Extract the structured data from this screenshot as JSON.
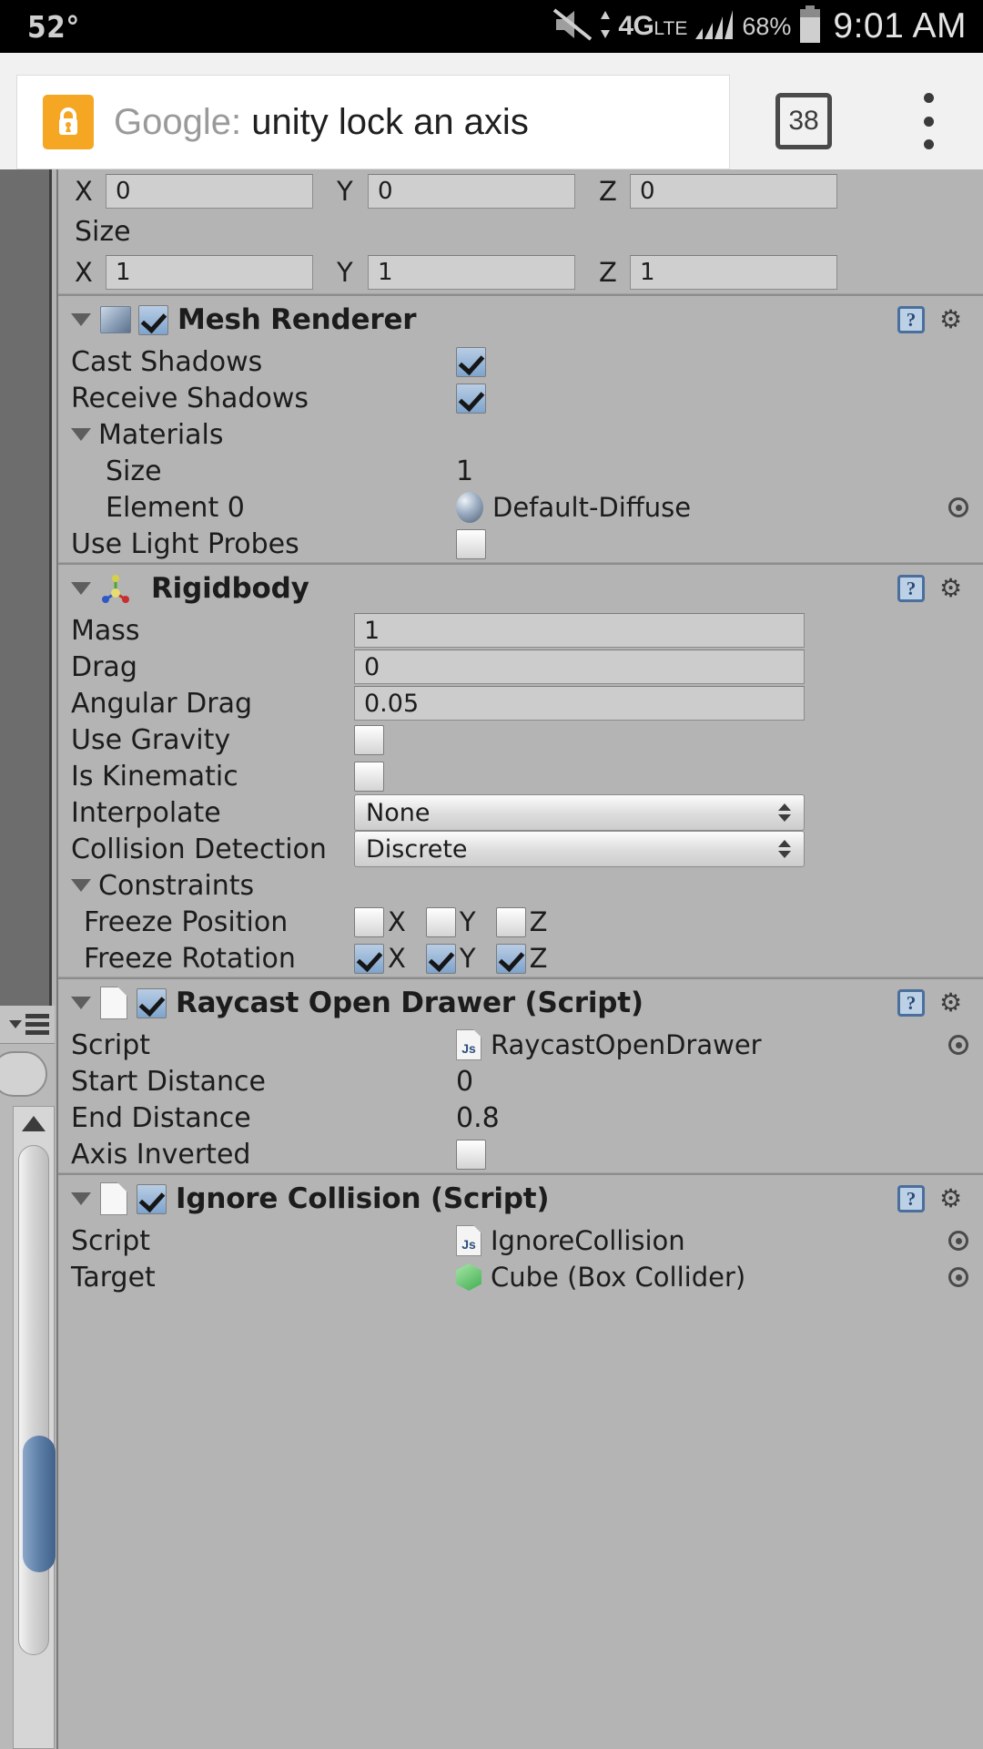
{
  "statusbar": {
    "temperature": "52°",
    "mute_icon": "mute-icon",
    "network": "4G",
    "network_suffix": "LTE",
    "signal_icon": "signal-bars-icon",
    "battery_percent": "68%",
    "battery_icon": "battery-icon",
    "time": "9:01 AM"
  },
  "browser": {
    "lock_icon": "lock-icon",
    "omnibox_prefix": "Google:",
    "omnibox_query": " unity lock an axis",
    "tab_count": "38",
    "menu_icon": "kebab-menu-icon",
    "accent_color": "#f5a623"
  },
  "inspector": {
    "transform_tail": {
      "position_row": {
        "x_label": "X",
        "x_value": "0",
        "y_label": "Y",
        "y_value": "0",
        "z_label": "Z",
        "z_value": "0"
      },
      "size_label": "Size",
      "size_row": {
        "x_label": "X",
        "x_value": "1",
        "y_label": "Y",
        "y_value": "1",
        "z_label": "Z",
        "z_value": "1"
      }
    },
    "mesh_renderer": {
      "title": "Mesh Renderer",
      "enabled": true,
      "icon": "mesh-renderer-icon",
      "help_glyph": "?",
      "gear_glyph": "⚙",
      "props": [
        {
          "label": "Cast Shadows",
          "type": "checkbox",
          "value": true
        },
        {
          "label": "Receive Shadows",
          "type": "checkbox",
          "value": true
        },
        {
          "label": "Materials",
          "type": "foldout"
        },
        {
          "label": "Size",
          "type": "text",
          "value": "1",
          "indent": 2
        },
        {
          "label": "Element 0",
          "type": "object",
          "value": "Default-Diffuse",
          "indent": 2,
          "icon": "material-sphere-icon"
        },
        {
          "label": "Use Light Probes",
          "type": "checkbox",
          "value": false
        }
      ]
    },
    "rigidbody": {
      "title": "Rigidbody",
      "icon": "rigidbody-axis-icon",
      "help_glyph": "?",
      "gear_glyph": "⚙",
      "props": [
        {
          "label": "Mass",
          "type": "field",
          "value": "1"
        },
        {
          "label": "Drag",
          "type": "field",
          "value": "0"
        },
        {
          "label": "Angular Drag",
          "type": "field",
          "value": "0.05"
        },
        {
          "label": "Use Gravity",
          "type": "checkbox",
          "value": false
        },
        {
          "label": "Is Kinematic",
          "type": "checkbox",
          "value": false
        },
        {
          "label": "Interpolate",
          "type": "popup",
          "value": "None"
        },
        {
          "label": "Collision Detection",
          "type": "popup",
          "value": "Discrete"
        }
      ],
      "constraints": {
        "label": "Constraints",
        "freeze_position": {
          "label": "Freeze Position",
          "x_label": "X",
          "y_label": "Y",
          "z_label": "Z",
          "x": false,
          "y": false,
          "z": false
        },
        "freeze_rotation": {
          "label": "Freeze Rotation",
          "x_label": "X",
          "y_label": "Y",
          "z_label": "Z",
          "x": true,
          "y": true,
          "z": true
        }
      }
    },
    "raycast_open_drawer": {
      "title": "Raycast Open Drawer (Script)",
      "enabled": true,
      "help_glyph": "?",
      "gear_glyph": "⚙",
      "props": [
        {
          "label": "Script",
          "type": "object",
          "value": "RaycastOpenDrawer",
          "icon": "js-script-icon"
        },
        {
          "label": "Start Distance",
          "type": "text",
          "value": "0"
        },
        {
          "label": "End Distance",
          "type": "text",
          "value": "0.8"
        },
        {
          "label": "Axis Inverted",
          "type": "checkbox",
          "value": false
        }
      ]
    },
    "ignore_collision": {
      "title": "Ignore Collision (Script)",
      "enabled": true,
      "help_glyph": "?",
      "gear_glyph": "⚙",
      "props": [
        {
          "label": "Script",
          "type": "object",
          "value": "IgnoreCollision",
          "icon": "js-script-icon"
        },
        {
          "label": "Target",
          "type": "object",
          "value": "Cube (Box Collider)",
          "icon": "cube-icon"
        }
      ]
    }
  }
}
